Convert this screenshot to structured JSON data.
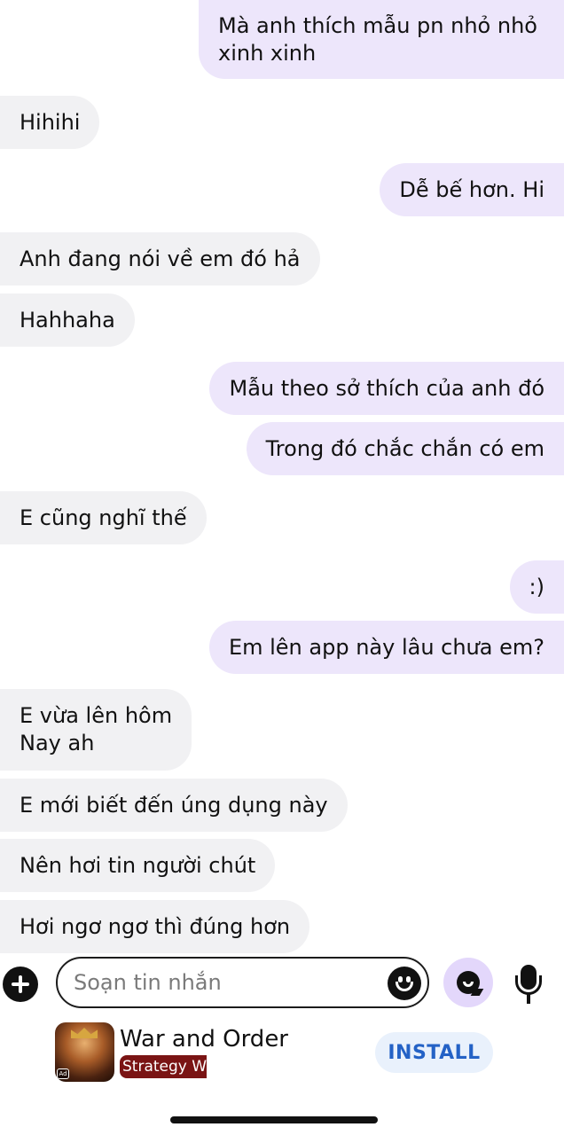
{
  "conversation": {
    "messages": [
      {
        "direction": "outgoing",
        "lines": [
          "Mà anh thích mẫu pn nhỏ nhỏ",
          "xinh xinh"
        ]
      },
      {
        "direction": "incoming",
        "lines": [
          "Hihihi"
        ]
      },
      {
        "direction": "outgoing",
        "lines": [
          "Dễ bế hơn. Hi"
        ]
      },
      {
        "direction": "incoming",
        "lines": [
          "Anh đang nói về em đó hả"
        ]
      },
      {
        "direction": "incoming",
        "lines": [
          "Hahhaha"
        ]
      },
      {
        "direction": "outgoing",
        "lines": [
          "Mẫu theo sở thích của anh đó"
        ]
      },
      {
        "direction": "outgoing",
        "lines": [
          "Trong đó chắc chắn có em"
        ]
      },
      {
        "direction": "incoming",
        "lines": [
          "E cũng nghĩ thế"
        ]
      },
      {
        "direction": "outgoing",
        "lines": [
          ":)"
        ]
      },
      {
        "direction": "outgoing",
        "lines": [
          "Em lên app này lâu chưa em?"
        ]
      },
      {
        "direction": "incoming",
        "lines": [
          "E vừa lên hôm",
          "Nay ah"
        ]
      },
      {
        "direction": "incoming",
        "lines": [
          "E mới biết đến úng dụng này"
        ]
      },
      {
        "direction": "incoming",
        "lines": [
          "Nên hơi tin người chút"
        ]
      },
      {
        "direction": "incoming",
        "lines": [
          "Hơi ngơ ngơ thì đúng hơn"
        ]
      }
    ]
  },
  "composer": {
    "placeholder": "Soạn tin nhắn",
    "value": "",
    "icons": {
      "add": "plus-circle-icon",
      "emoji": "smiley-icon",
      "ai": "chat-bubble-icon",
      "voice": "microphone-icon"
    },
    "ai_button_color": "#e3d7fb"
  },
  "ad": {
    "app_name": "War and Order",
    "category": "Strategy W",
    "icon_badge": "Ad",
    "install_label": "INSTALL",
    "install_color": "#2462c6"
  },
  "colors": {
    "incoming_bubble": "#f1f1f3",
    "outgoing_bubble": "#ede6fb"
  }
}
